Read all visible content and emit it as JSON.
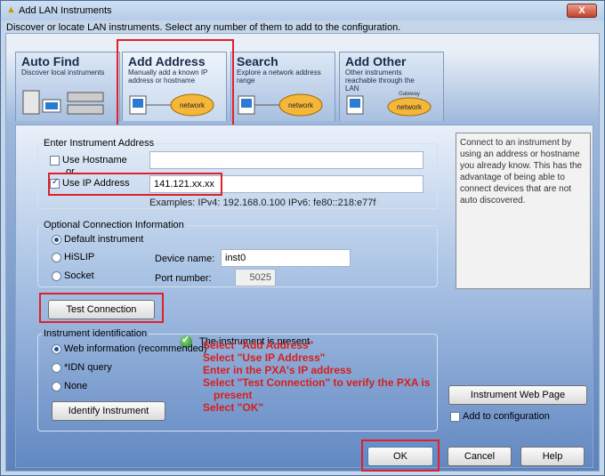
{
  "window": {
    "title": "Add LAN Instruments",
    "subtitle": "Discover or locate LAN instruments. Select any number of them to add to the configuration.",
    "close_label": "X"
  },
  "tabs": [
    {
      "title": "Auto Find",
      "desc": "Discover local instruments"
    },
    {
      "title": "Add Address",
      "desc": "Manually add a known IP address or hostname",
      "illus_label": "network",
      "active": true
    },
    {
      "title": "Search",
      "desc": "Explore a network address range",
      "illus_label": "network"
    },
    {
      "title": "Add Other",
      "desc": "Other instruments reachable through the LAN",
      "gateway_label": "Gateway",
      "illus_label": "network"
    }
  ],
  "address_group": {
    "legend": "Enter Instrument Address",
    "hostname_label": "Use Hostname",
    "or_label": "or",
    "ip_label": "Use IP Address",
    "ip_value": "141.121.xx.xx",
    "hostname_value": "",
    "examples": "Examples: IPv4: 192.168.0.100   IPv6: fe80::218:e77f"
  },
  "optional_group": {
    "legend": "Optional Connection Information",
    "default_label": "Default instrument",
    "hislip_label": "HiSLIP",
    "socket_label": "Socket",
    "device_name_label": "Device name:",
    "device_name_value": "inst0",
    "port_label": "Port number:",
    "port_value": "5025"
  },
  "test": {
    "button_label": "Test Connection",
    "status_text": "The instrument is present"
  },
  "ident_group": {
    "legend": "Instrument identification",
    "web_label": "Web information (recommended)",
    "idn_label": "*IDN query",
    "none_label": "None",
    "identify_button": "Identify Instrument"
  },
  "help_text": "Connect to an instrument by using an address or hostname you already know. This has the advantage of being able to connect devices that are not auto discovered.",
  "instructions": [
    "Select \"Add Address\"",
    "Select \"Use IP Address\"",
    "Enter in the PXA's IP address",
    "Select \"Test Connection\" to verify the PXA is",
    "present",
    "Select \"OK\""
  ],
  "side": {
    "web_page_button": "Instrument Web Page",
    "add_config_label": "Add to configuration"
  },
  "footer": {
    "ok": "OK",
    "cancel": "Cancel",
    "help": "Help"
  },
  "colors": {
    "annotation_red": "#e0202a",
    "instruction_red": "#d81e1e",
    "accent_blue": "#5c82bc"
  }
}
